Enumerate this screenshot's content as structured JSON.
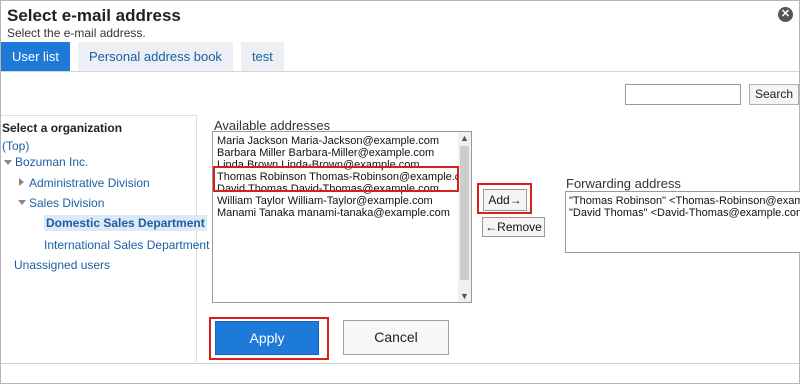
{
  "dialog": {
    "title": "Select e-mail address",
    "subtitle": "Select the e-mail address.",
    "close_icon": "close-icon"
  },
  "tabs": [
    {
      "label": "User list",
      "active": true
    },
    {
      "label": "Personal address book",
      "active": false
    },
    {
      "label": "test",
      "active": false
    }
  ],
  "search": {
    "value": "",
    "button_label": "Search"
  },
  "organization": {
    "heading": "Select a organization",
    "items": [
      {
        "label": "(Top)"
      },
      {
        "label": "Bozuman Inc."
      },
      {
        "label": "Administrative Division"
      },
      {
        "label": "Sales Division"
      },
      {
        "label": "Domestic Sales Department",
        "selected": true
      },
      {
        "label": "International Sales Department"
      },
      {
        "label": "Unassigned users"
      }
    ]
  },
  "available": {
    "label": "Available addresses",
    "items": [
      "Maria Jackson Maria-Jackson@example.com",
      "Barbara Miller Barbara-Miller@example.com",
      "Linda Brown Linda-Brown@example.com",
      "Thomas Robinson Thomas-Robinson@example.com",
      "David Thomas David-Thomas@example.com",
      "William Taylor William-Taylor@example.com",
      "Manami Tanaka manami-tanaka@example.com"
    ]
  },
  "actions": {
    "add_label": "Add→",
    "remove_label": "←Remove"
  },
  "forwarding": {
    "label": "Forwarding address",
    "items": [
      "\"Thomas Robinson\" <Thomas-Robinson@example.com>",
      "\"David Thomas\" <David-Thomas@example.com>"
    ]
  },
  "footer": {
    "apply_label": "Apply",
    "cancel_label": "Cancel"
  },
  "colors": {
    "accent": "#1e7ad8",
    "highlight": "#d7201e",
    "link": "#1a5fa6"
  }
}
